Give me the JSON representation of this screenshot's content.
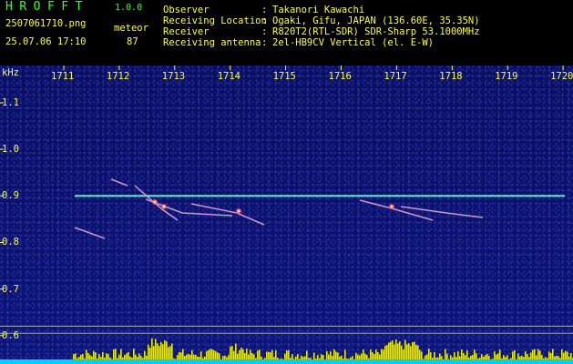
{
  "header": {
    "app_name": "HROFFT",
    "version": "1.0.0",
    "file_name": "2507061710.png",
    "datetime": "25.07.06 17:10",
    "meteor_label": "meteor",
    "meteor_count": "87",
    "info": [
      {
        "key": "Observer",
        "value": "Takanori Kawachi"
      },
      {
        "key": "Receiving Location",
        "value": "Ogaki, Gifu, JAPAN (136.60E, 35.35N)"
      },
      {
        "key": "Receiver",
        "value": "R820T2(RTL-SDR) SDR-Sharp 53.1000MHz"
      },
      {
        "key": "Receiving antenna",
        "value": "2el-HB9CV Vertical (el. E-W)"
      }
    ],
    "colon": ":"
  },
  "chart_data": {
    "type": "heatmap",
    "ylabel": "kHz",
    "x_ticks": [
      "1711",
      "1712",
      "1713",
      "1714",
      "1715",
      "1716",
      "1717",
      "1718",
      "1719",
      "1720"
    ],
    "y_ticks": [
      "1.1",
      "1.0",
      "0.9",
      "0.8",
      "0.7",
      "0.6"
    ],
    "ylim": [
      0.58,
      1.18
    ],
    "grid": true,
    "carrier_khz": 0.9,
    "colors": {
      "background": "#0b1068",
      "text": "#ffff33",
      "accent": "#33ff33",
      "carrier": "#66ffcc",
      "bars": "#ffff00",
      "baseline": "#00d0ff"
    }
  }
}
